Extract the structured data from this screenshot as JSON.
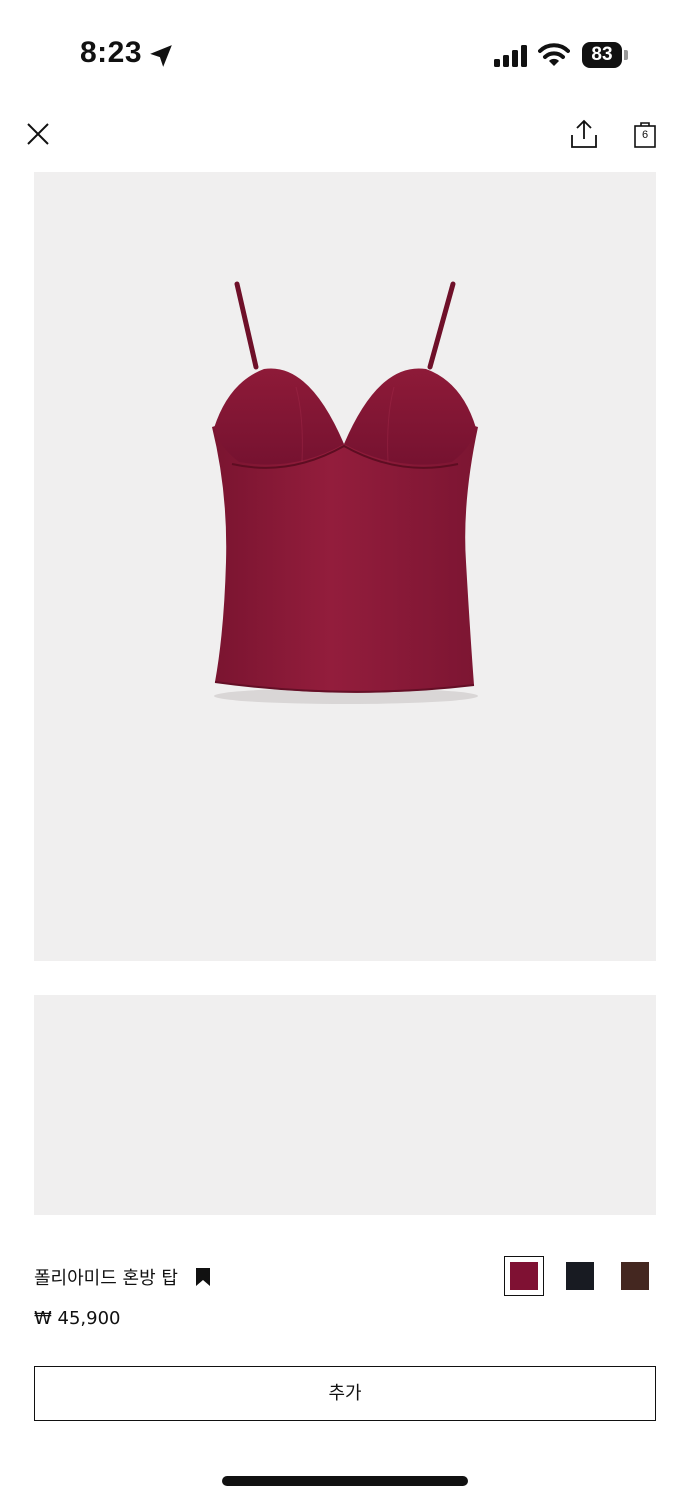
{
  "status_bar": {
    "time": "8:23",
    "battery": "83"
  },
  "nav": {
    "bag_count": "6"
  },
  "product": {
    "name": "폴리아미드 혼방 탑",
    "price": "₩ 45,900",
    "colors": [
      {
        "name": "burgundy",
        "hex": "#7f1133",
        "selected": true
      },
      {
        "name": "black",
        "hex": "#181b22",
        "selected": false
      },
      {
        "name": "brown",
        "hex": "#442720",
        "selected": false
      }
    ],
    "garment_color": "#8a1a36"
  },
  "actions": {
    "add_label": "추가"
  },
  "icons": {
    "close": "close-icon",
    "share": "share-icon",
    "bag": "shopping-bag-icon",
    "bookmark": "bookmark-icon",
    "location": "location-arrow-icon",
    "signal": "cellular-signal-icon",
    "wifi": "wifi-icon"
  }
}
